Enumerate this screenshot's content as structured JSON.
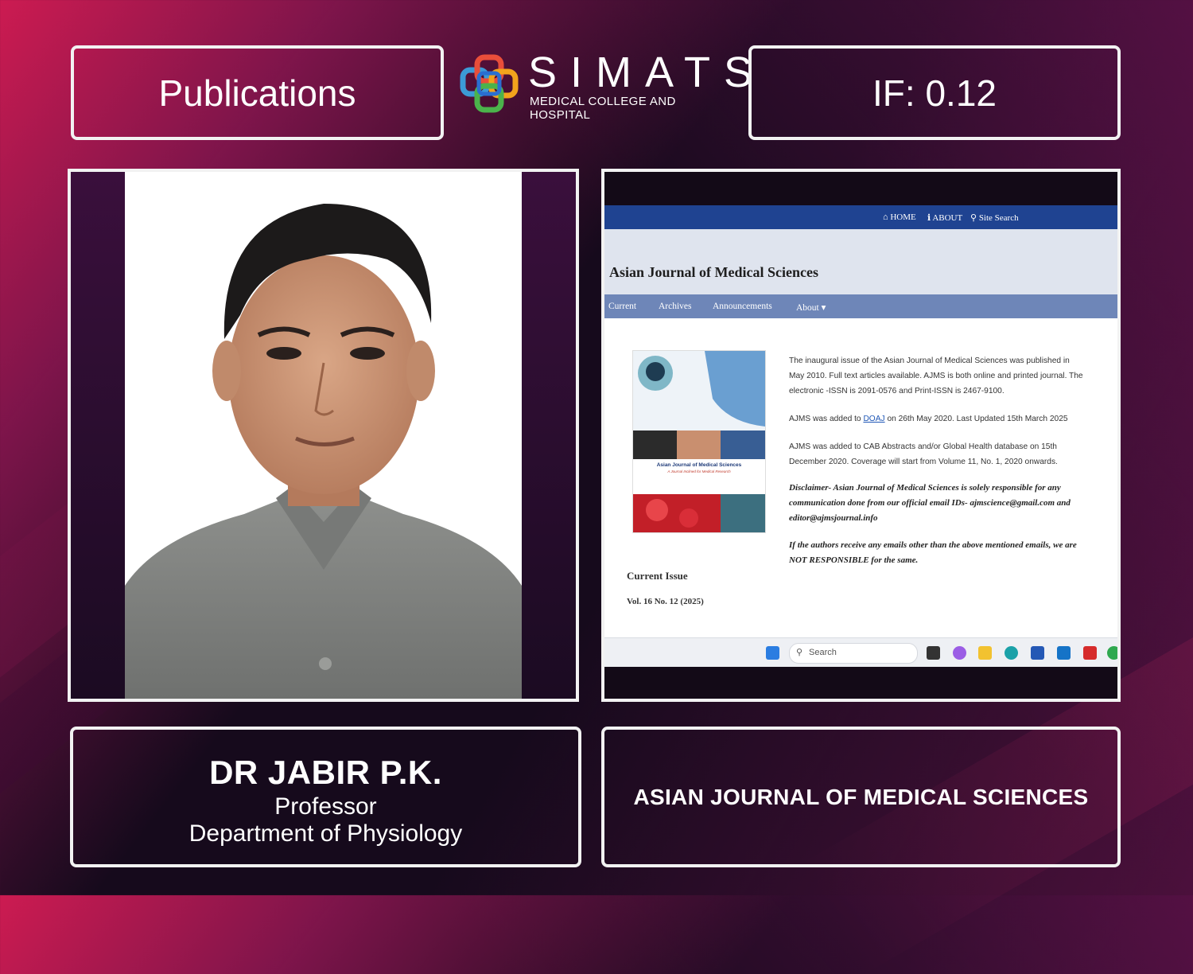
{
  "header": {
    "left_label": "Publications",
    "right_label": "IF: 0.12",
    "logo": {
      "wordmark": "SIMATS",
      "subtitle": "MEDICAL COLLEGE AND HOSPITAL",
      "mark_colors": [
        "#e94e3a",
        "#f2a31c",
        "#3c9ad6",
        "#4bb34b",
        "#2a6fd1"
      ]
    }
  },
  "photo": {
    "alt": "portrait-photo"
  },
  "screenshot": {
    "topnav": {
      "home": "HOME",
      "about": "ABOUT",
      "search": "Site Search"
    },
    "site_title": "Asian Journal of Medical Sciences",
    "menu": {
      "current": "Current",
      "archives": "Archives",
      "announcements": "Announcements",
      "about": "About"
    },
    "cover": {
      "title": "Asian Journal of Medical Sciences",
      "subtitle": "A Journal Inclined for Medical Research"
    },
    "paragraphs": {
      "p1": "The inaugural issue of the Asian Journal of Medical Sciences was published in May 2010. Full text articles available. AJMS is both online and printed journal. The electronic -ISSN is  2091-0576 and Print-ISSN is 2467-9100.",
      "p2_before": "AJMS was added to ",
      "p2_link": "DOAJ",
      "p2_after": " on 26th May 2020. Last Updated 15th March 2025",
      "p3": "AJMS was added to CAB Abstracts and/or Global Health database on 15th December 2020. Coverage will start from Volume 11, No. 1, 2020 onwards.",
      "p4": "Disclaimer- Asian Journal of Medical Sciences is solely responsible for any communication done from our official email IDs- ajmscience@gmail.com and editor@ajmsjournal.info",
      "p5": "If the authors receive any emails other than the above mentioned emails, we are NOT RESPONSIBLE for the same."
    },
    "current_issue_heading": "Current Issue",
    "volume": "Vol. 16 No. 12 (2025)",
    "taskbar": {
      "search_placeholder": "Search"
    }
  },
  "person": {
    "name": "DR JABIR P.K.",
    "role": "Professor",
    "department": "Department of Physiology"
  },
  "journal": {
    "name": "ASIAN JOURNAL OF MEDICAL SCIENCES"
  }
}
